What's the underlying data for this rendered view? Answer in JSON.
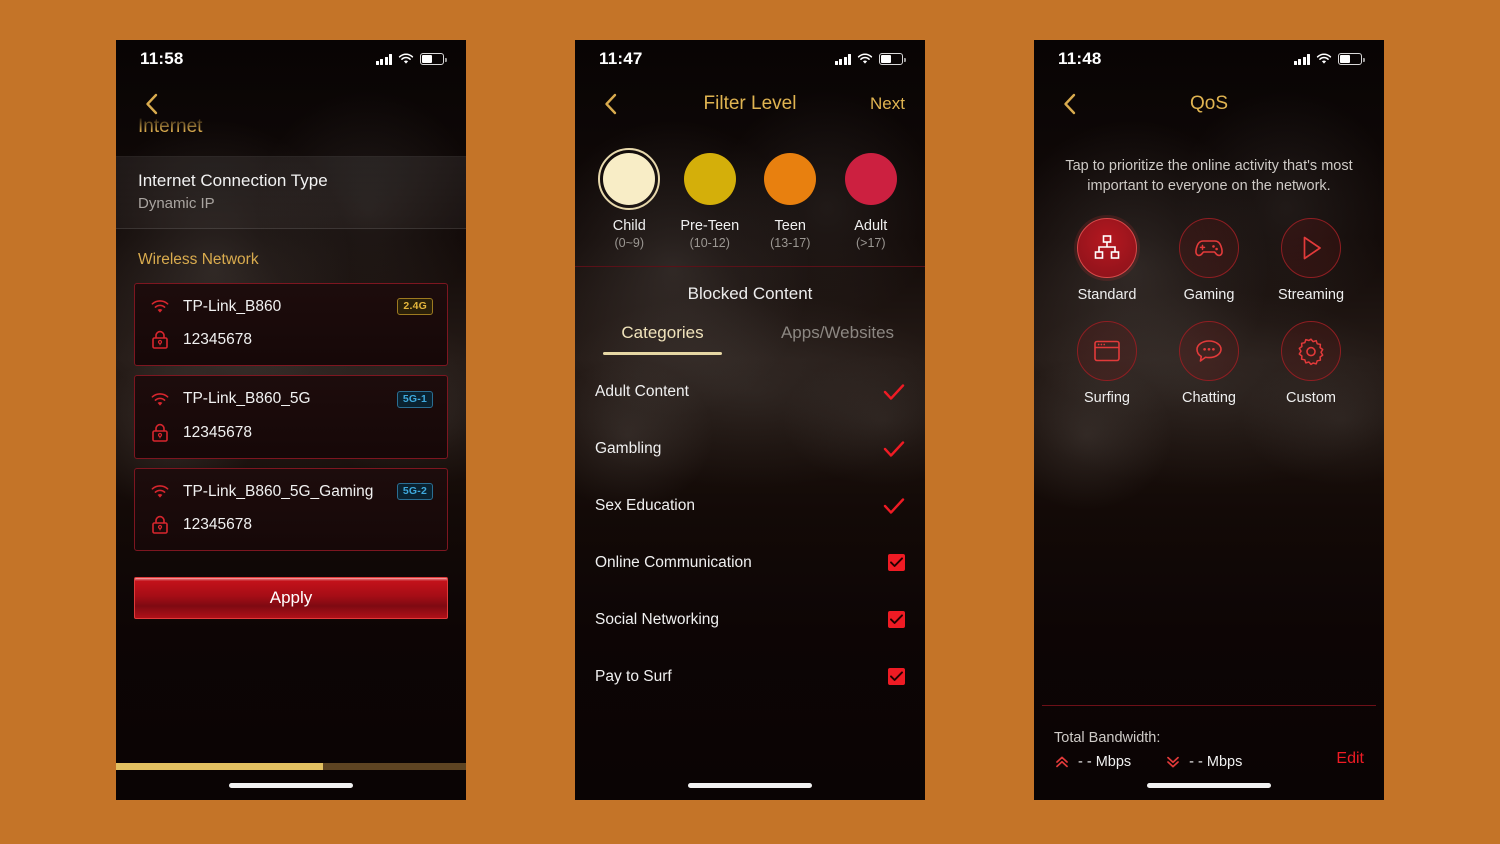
{
  "background_color": "#c47428",
  "phone1": {
    "status_bar": {
      "time": "11:58",
      "signal_icon": "cellular-bars-icon",
      "wifi_icon": "wifi-icon",
      "battery_icon": "battery-icon"
    },
    "nav": {
      "back_icon": "chevron-left-icon"
    },
    "scrolled_title": "Internet",
    "connection": {
      "title": "Internet Connection Type",
      "value": "Dynamic IP"
    },
    "section_label": "Wireless Network",
    "networks": [
      {
        "wifi_icon": "wifi-icon",
        "ssid": "TP-Link_B860",
        "band": "2.4G",
        "band_type": "g24",
        "lock_icon": "lock-icon",
        "password": "12345678"
      },
      {
        "wifi_icon": "wifi-icon",
        "ssid": "TP-Link_B860_5G",
        "band": "5G-1",
        "band_type": "g5",
        "lock_icon": "lock-icon",
        "password": "12345678"
      },
      {
        "wifi_icon": "wifi-icon",
        "ssid": "TP-Link_B860_5G_Gaming",
        "band": "5G-2",
        "band_type": "g5",
        "lock_icon": "lock-icon",
        "password": "12345678"
      }
    ],
    "apply_label": "Apply",
    "progress_percent": 59
  },
  "phone2": {
    "status_bar": {
      "time": "11:47",
      "signal_icon": "cellular-bars-icon",
      "wifi_icon": "wifi-icon",
      "battery_icon": "battery-icon"
    },
    "nav": {
      "back_icon": "chevron-left-icon",
      "title": "Filter Level",
      "next_label": "Next"
    },
    "filter_levels": [
      {
        "name": "Child",
        "age": "(0~9)",
        "color": "#f8edc6",
        "selected": true
      },
      {
        "name": "Pre-Teen",
        "age": "(10-12)",
        "color": "#d4af0a",
        "selected": false
      },
      {
        "name": "Teen",
        "age": "(13-17)",
        "color": "#e8800f",
        "selected": false
      },
      {
        "name": "Adult",
        "age": "(>17)",
        "color": "#cc2040",
        "selected": false
      }
    ],
    "blocked_title": "Blocked Content",
    "tabs": [
      {
        "label": "Categories",
        "active": true
      },
      {
        "label": "Apps/Websites",
        "active": false
      }
    ],
    "categories": [
      {
        "name": "Adult Content",
        "style": "check",
        "checked": true
      },
      {
        "name": "Gambling",
        "style": "check",
        "checked": true
      },
      {
        "name": "Sex Education",
        "style": "check",
        "checked": true
      },
      {
        "name": "Online Communication",
        "style": "box",
        "checked": true
      },
      {
        "name": "Social Networking",
        "style": "box",
        "checked": true
      },
      {
        "name": "Pay to Surf",
        "style": "box",
        "checked": true
      }
    ]
  },
  "phone3": {
    "status_bar": {
      "time": "11:48",
      "signal_icon": "cellular-bars-icon",
      "wifi_icon": "wifi-icon",
      "battery_icon": "battery-icon"
    },
    "nav": {
      "back_icon": "chevron-left-icon",
      "title": "QoS"
    },
    "hint": "Tap to prioritize the online activity that's most important to everyone on the network.",
    "modes": [
      {
        "label": "Standard",
        "icon": "network-hierarchy-icon",
        "selected": true
      },
      {
        "label": "Gaming",
        "icon": "gamepad-icon",
        "selected": false
      },
      {
        "label": "Streaming",
        "icon": "play-triangle-icon",
        "selected": false
      },
      {
        "label": "Surfing",
        "icon": "browser-window-icon",
        "selected": false
      },
      {
        "label": "Chatting",
        "icon": "chat-bubble-icon",
        "selected": false
      },
      {
        "label": "Custom",
        "icon": "gear-icon",
        "selected": false
      }
    ],
    "bandwidth": {
      "title": "Total Bandwidth:",
      "upload_icon": "chevron-up-double-icon",
      "upload_value": "- - Mbps",
      "download_icon": "chevron-down-double-icon",
      "download_value": "- - Mbps",
      "edit_label": "Edit"
    }
  }
}
